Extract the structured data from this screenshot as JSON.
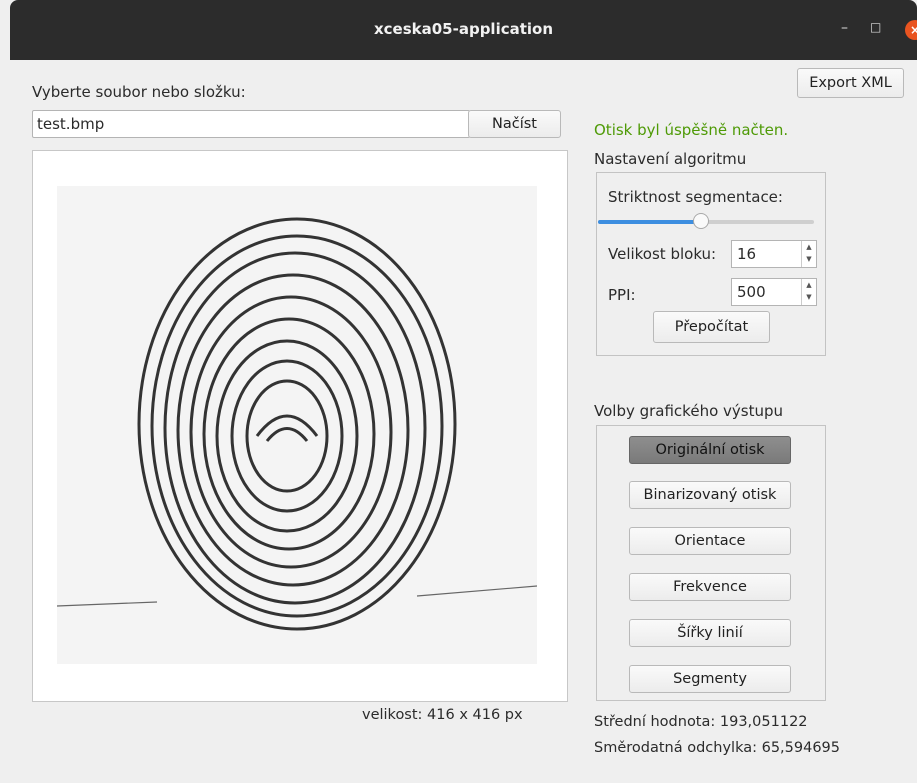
{
  "window": {
    "title": "xceska05-application",
    "minimize": "–",
    "maximize": "□",
    "close": "×"
  },
  "file": {
    "prompt": "Vyberte soubor nebo složku:",
    "value": "test.bmp",
    "load_button": "Načíst"
  },
  "export_button": "Export XML",
  "status": {
    "text": "Otisk byl úspěšně načten.",
    "color": "#4e9a06"
  },
  "algorithm": {
    "title": "Nastavení algoritmu",
    "segmentation_label": "Striktnost segmentace:",
    "segmentation_level": 0.47,
    "block_size_label": "Velikost bloku:",
    "block_size_value": "16",
    "ppi_label": "PPI:",
    "ppi_value": "500",
    "recalc_button": "Přepočítat"
  },
  "output": {
    "title": "Volby grafického výstupu",
    "options": [
      {
        "label": "Originální otisk",
        "selected": true
      },
      {
        "label": "Binarizovaný otisk",
        "selected": false
      },
      {
        "label": "Orientace",
        "selected": false
      },
      {
        "label": "Frekvence",
        "selected": false
      },
      {
        "label": "Šířky linií",
        "selected": false
      },
      {
        "label": "Segmenty",
        "selected": false
      }
    ]
  },
  "image": {
    "size_text": "velikost: 416 x 416 px"
  },
  "stats": {
    "mean": "Střední hodnota: 193,051122",
    "std": "Směrodatná odchylka: 65,594695"
  },
  "colors": {
    "accent": "#3d8ee0",
    "titlebar": "#2c2c2c",
    "close": "#e95420"
  },
  "icons": {
    "spin_up": "arrow-up-icon",
    "spin_down": "arrow-down-icon"
  }
}
